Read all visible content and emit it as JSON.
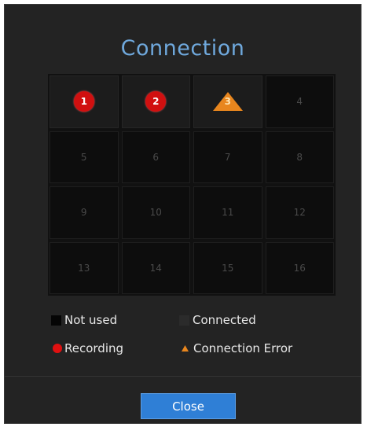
{
  "dialog": {
    "title": "Connection",
    "close_label": "Close"
  },
  "channels": [
    {
      "number": "1",
      "status": "recording"
    },
    {
      "number": "2",
      "status": "recording"
    },
    {
      "number": "3",
      "status": "connection-error"
    },
    {
      "number": "4",
      "status": "connected"
    },
    {
      "number": "5",
      "status": "not-used"
    },
    {
      "number": "6",
      "status": "not-used"
    },
    {
      "number": "7",
      "status": "not-used"
    },
    {
      "number": "8",
      "status": "not-used"
    },
    {
      "number": "9",
      "status": "not-used"
    },
    {
      "number": "10",
      "status": "not-used"
    },
    {
      "number": "11",
      "status": "not-used"
    },
    {
      "number": "12",
      "status": "not-used"
    },
    {
      "number": "13",
      "status": "not-used"
    },
    {
      "number": "14",
      "status": "not-used"
    },
    {
      "number": "15",
      "status": "not-used"
    },
    {
      "number": "16",
      "status": "not-used"
    }
  ],
  "legend": {
    "not_used": "Not used",
    "connected": "Connected",
    "recording": "Recording",
    "connection_error": "Connection Error"
  },
  "icons": {
    "recording": "red-circle-icon",
    "connection_error": "orange-triangle-icon"
  },
  "colors": {
    "title": "#6fa8dc",
    "recording": "#d11010",
    "connection_error": "#e8861e",
    "close_button": "#2f7fd6"
  }
}
